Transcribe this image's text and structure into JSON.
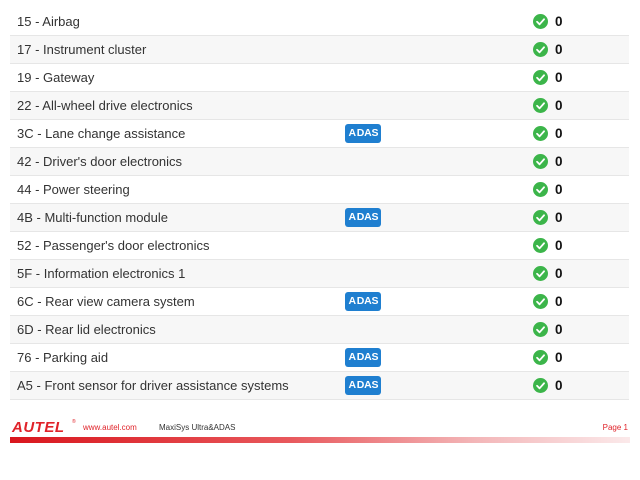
{
  "modules": [
    {
      "name": "15 - Airbag",
      "adas": false,
      "count": "0"
    },
    {
      "name": "17 - Instrument cluster",
      "adas": false,
      "count": "0"
    },
    {
      "name": "19 - Gateway",
      "adas": false,
      "count": "0"
    },
    {
      "name": "22 - All-wheel drive electronics",
      "adas": false,
      "count": "0"
    },
    {
      "name": "3C - Lane change assistance",
      "adas": true,
      "count": "0"
    },
    {
      "name": "42 - Driver's door electronics",
      "adas": false,
      "count": "0"
    },
    {
      "name": "44 - Power steering",
      "adas": false,
      "count": "0"
    },
    {
      "name": "4B - Multi-function module",
      "adas": true,
      "count": "0"
    },
    {
      "name": "52 - Passenger's door electronics",
      "adas": false,
      "count": "0"
    },
    {
      "name": "5F - Information electronics 1",
      "adas": false,
      "count": "0"
    },
    {
      "name": "6C - Rear view camera system",
      "adas": true,
      "count": "0"
    },
    {
      "name": "6D - Rear lid electronics",
      "adas": false,
      "count": "0"
    },
    {
      "name": "76 - Parking aid",
      "adas": true,
      "count": "0"
    },
    {
      "name": "A5 - Front sensor for driver assistance systems",
      "adas": true,
      "count": "0"
    }
  ],
  "badge": {
    "prefix": "A",
    "suffix": "DAS",
    "color": "#1f7fd0"
  },
  "status_icon": {
    "name": "check-circle-icon",
    "color": "#3cb54a"
  },
  "footer": {
    "logo": "AUTEL",
    "logo_mark": "®",
    "website": "www.autel.com",
    "product": "MaxiSys Ultra&ADAS",
    "page": "Page 1",
    "accent_color": "#e0232a"
  }
}
